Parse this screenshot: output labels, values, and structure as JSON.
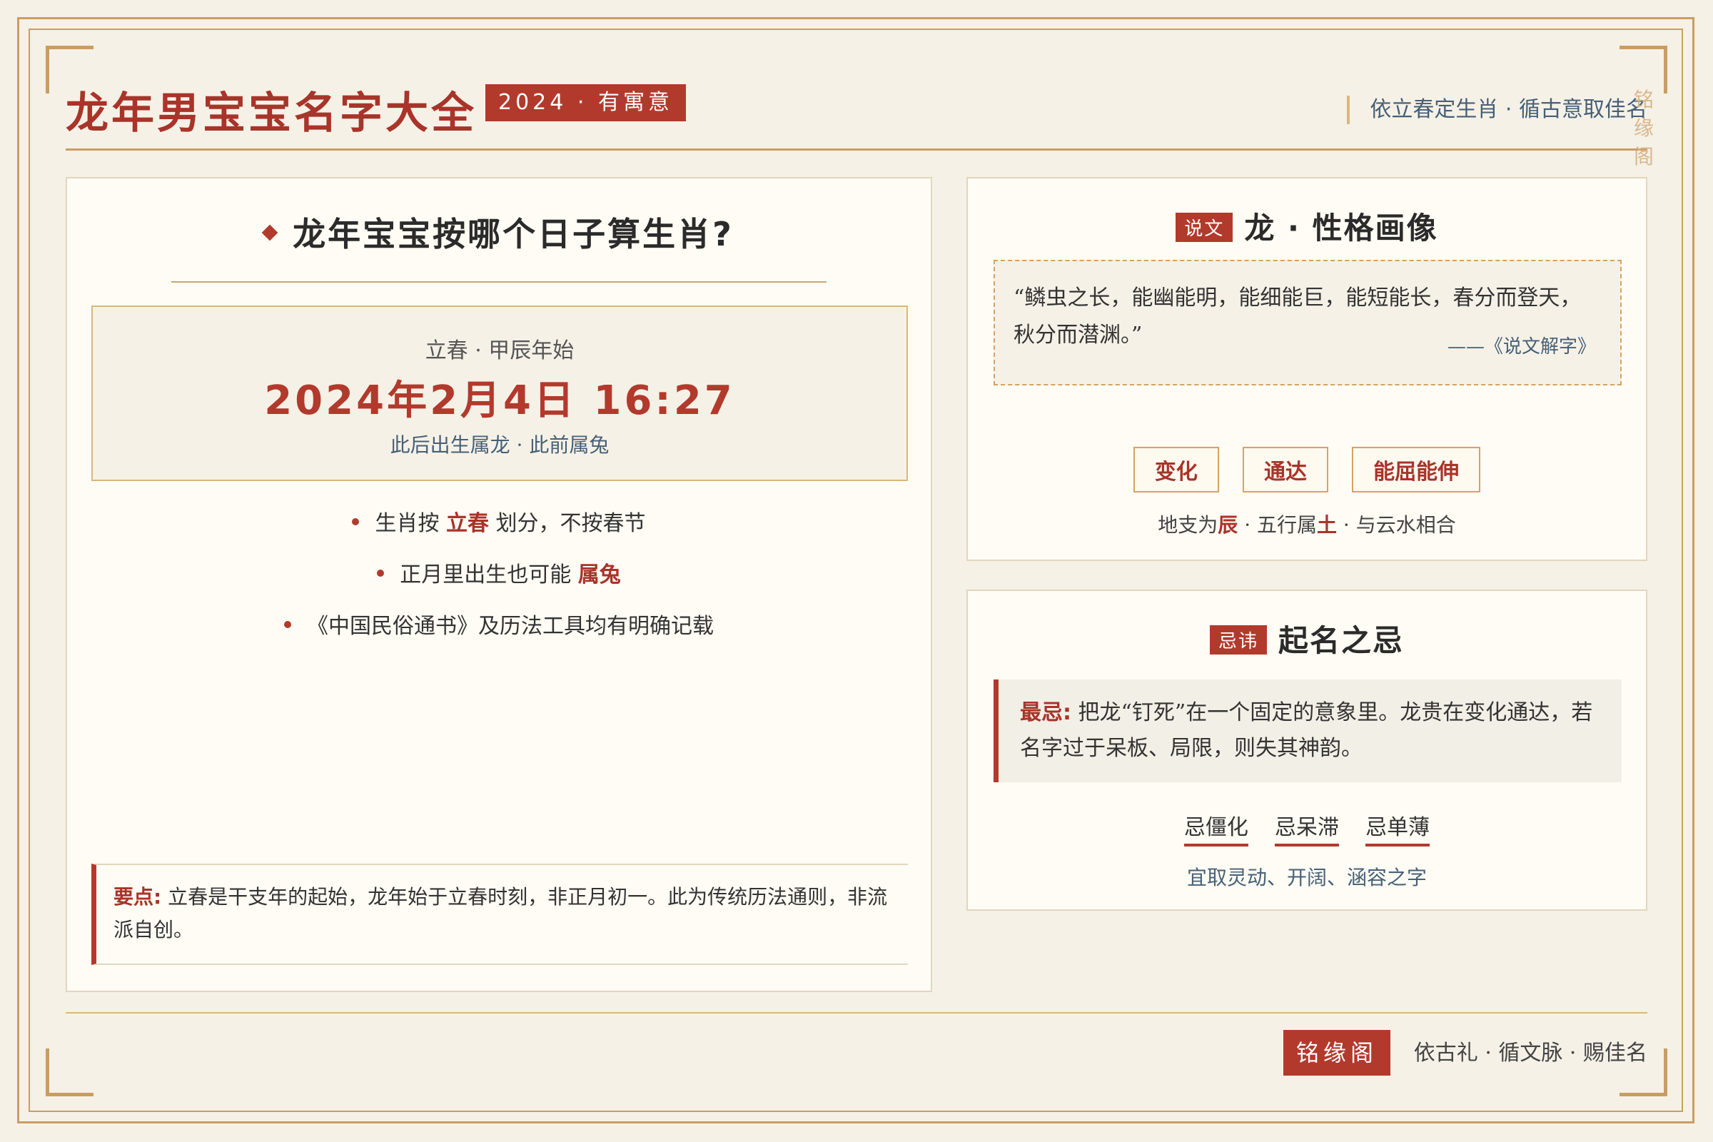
{
  "header": {
    "title": "龙年男宝宝名字大全",
    "badge": "2024 · 有寓意",
    "slogan": "依立春定生肖 · 循古意取佳名",
    "vertical_mark": [
      "铭",
      "缘",
      "阁"
    ]
  },
  "left_panel": {
    "title": "龙年宝宝按哪个日子算生肖?",
    "date_box": {
      "subtitle": "立春 · 甲辰年始",
      "date": "2024年2月4日 16:27",
      "note": "此后出生属龙 · 此前属兔"
    },
    "bullets": [
      {
        "before": "生肖按 ",
        "em": "立春",
        "after": " 划分，不按春节"
      },
      {
        "before": "正月里出生也可能 ",
        "em": "属兔",
        "after": ""
      },
      {
        "before": "《中国民俗通书》及历法工具均有明确记载",
        "em": "",
        "after": ""
      }
    ],
    "key_note": {
      "label": "要点:",
      "text": "立春是干支年的起始，龙年始于立春时刻，非正月初一。此为传统历法通则，非流派自创。"
    }
  },
  "personality": {
    "tag": "说文",
    "title": "龙 · 性格画像",
    "quote": "“鳞虫之长，能幽能明，能细能巨，能短能长，春分而登天，秋分而潜渊。”",
    "source": "——《说文解字》",
    "traits": [
      "变化",
      "通达",
      "能屈能伸"
    ],
    "branch": {
      "p1": "地支为",
      "e1": "辰",
      "p2": " · 五行属",
      "e2": "土",
      "p3": " · 与云水相合"
    }
  },
  "taboo": {
    "tag": "忌讳",
    "title": "起名之忌",
    "warn_label": "最忌:",
    "warn_text": "把龙“钉死”在一个固定的意象里。龙贵在变化通达，若名字过于呆板、局限，则失其神韵。",
    "avoid": [
      "忌僵化",
      "忌呆滞",
      "忌单薄"
    ],
    "tip": "宜取灵动、开阔、涵容之字"
  },
  "footer": {
    "brand": "铭缘阁",
    "text": "依古礼 · 循文脉 · 赐佳名"
  },
  "colors": {
    "accent": "#b23a2c",
    "gold": "#c99d62",
    "background": "#f6f1e7",
    "muted_blue": "#466076"
  }
}
